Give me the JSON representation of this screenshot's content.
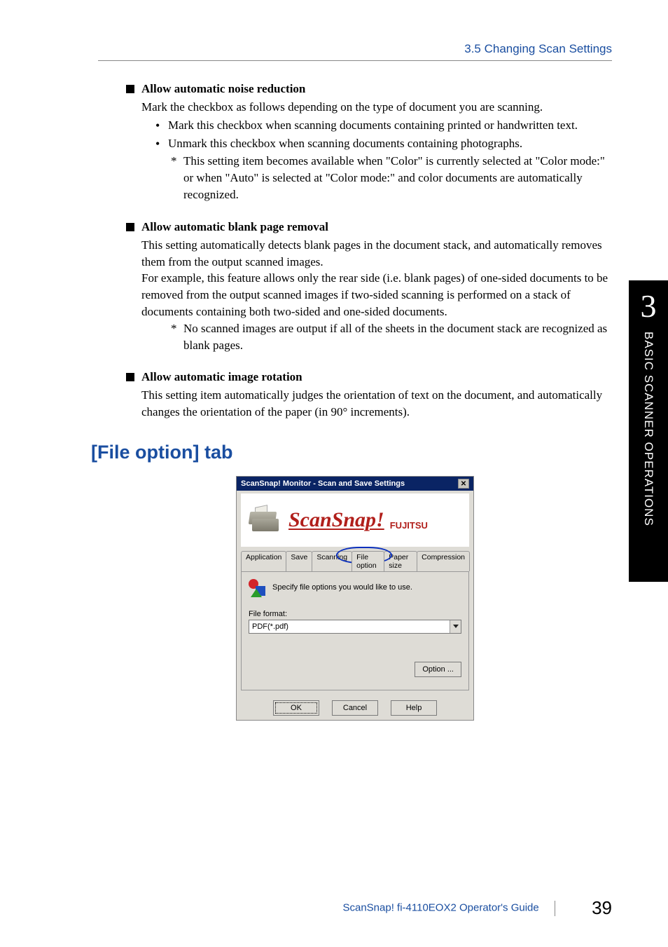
{
  "header": {
    "section_ref": "3.5 Changing Scan Settings"
  },
  "sections": {
    "noise": {
      "title": "Allow automatic noise reduction",
      "intro": "Mark the checkbox as follows depending on the type of document you are scanning.",
      "bullet1": "Mark this checkbox when scanning documents containing printed or handwritten text.",
      "bullet2": "Unmark this checkbox when scanning documents containing photographs.",
      "note": "This setting item becomes available when \"Color\" is currently selected at \"Color mode:\" or when \"Auto\" is selected at \"Color mode:\" and color documents are automatically recognized."
    },
    "blank": {
      "title": "Allow automatic blank page removal",
      "p1": "This setting automatically detects blank pages in the document stack, and automatically removes them from the output scanned images.",
      "p2": "For example, this feature allows only the rear side (i.e. blank pages) of one-sided documents to be removed from the output scanned images if two-sided scanning is performed on a stack of documents containing both two-sided and one-sided documents.",
      "note": "No scanned images are output if all of the sheets in the document stack are recognized as blank pages."
    },
    "rotate": {
      "title": "Allow automatic image rotation",
      "p1": "This setting item automatically judges the orientation of text on the document, and automatically changes the orientation of the paper (in 90° increments)."
    }
  },
  "chapter_heading": "[File option] tab",
  "dialog": {
    "title": "ScanSnap! Monitor - Scan and Save Settings",
    "logo_main": "ScanSnap!",
    "logo_sub": "FUJITSU",
    "tabs": {
      "application": "Application",
      "save": "Save",
      "scanning": "Scanning",
      "file_option": "File option",
      "paper_size": "Paper size",
      "compression": "Compression"
    },
    "hint": "Specify file options you would like to use.",
    "file_format_label": "File format:",
    "file_format_value": "PDF(*.pdf)",
    "option_btn": "Option ...",
    "ok": "OK",
    "cancel": "Cancel",
    "help": "Help"
  },
  "side": {
    "num": "3",
    "label": "BASIC SCANNER OPERATIONS"
  },
  "footer": {
    "guide": "ScanSnap! fi-4110EOX2 Operator's Guide",
    "page": "39"
  }
}
